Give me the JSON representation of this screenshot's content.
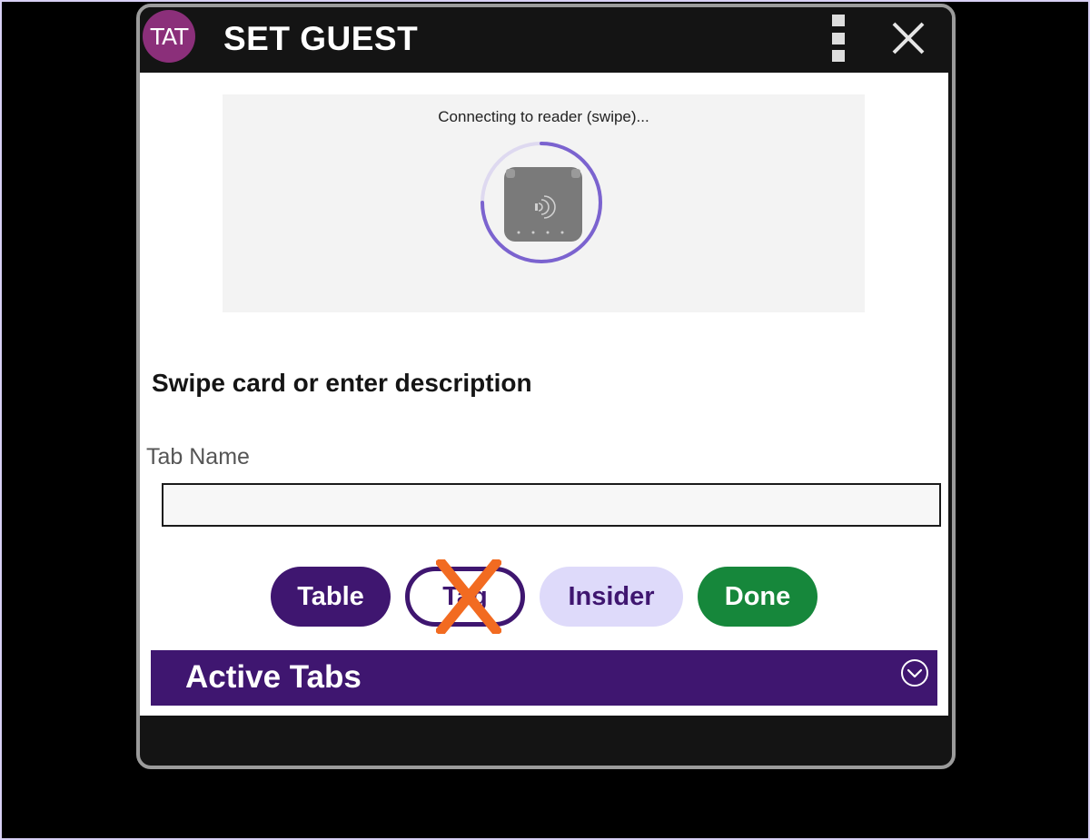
{
  "dialog": {
    "logo_text": "TAT",
    "title": "SET GUEST"
  },
  "reader": {
    "status": "Connecting to reader (swipe)..."
  },
  "form": {
    "heading": "Swipe card or enter description",
    "tab_name_label": "Tab Name",
    "tab_name_value": ""
  },
  "buttons": {
    "table": "Table",
    "tag": "Tag",
    "insider": "Insider",
    "done": "Done"
  },
  "active_tabs": {
    "label": "Active Tabs"
  },
  "colors": {
    "primary": "#3f1670",
    "success": "#16873b",
    "light_accent": "#dedafa",
    "disabled_mark": "#f26b21"
  },
  "icons": [
    "kebab-menu-icon",
    "close-icon",
    "card-reader-icon",
    "chevron-down-icon",
    "disabled-x-icon"
  ]
}
